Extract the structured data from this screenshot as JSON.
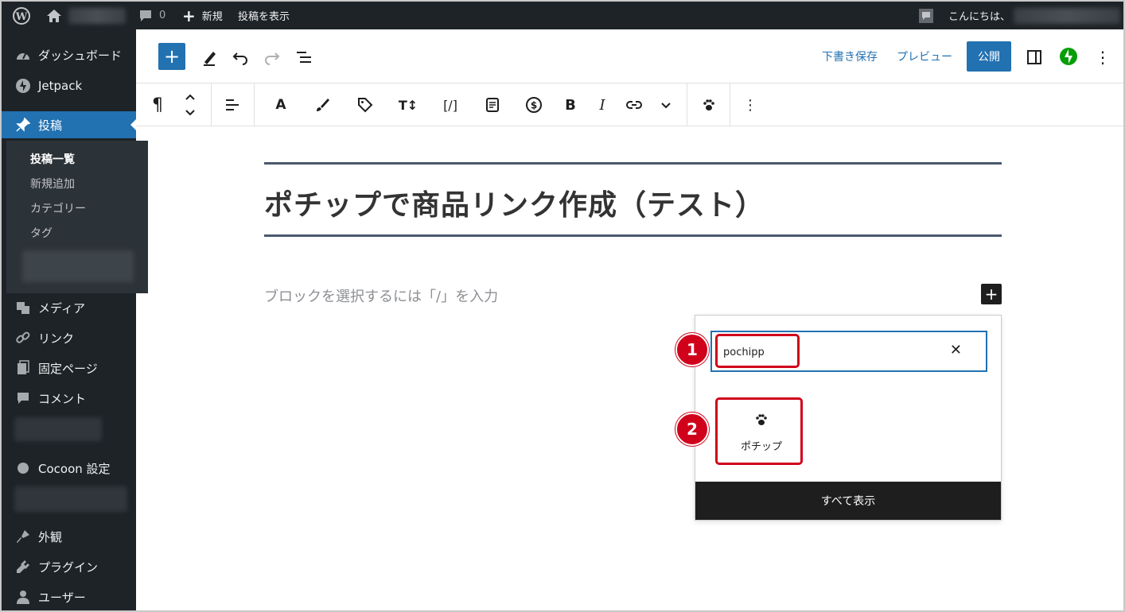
{
  "adminbar": {
    "comments_count": "0",
    "new_label": "新規",
    "view_post_label": "投稿を表示",
    "greeting": "こんにちは、"
  },
  "sidebar": {
    "items": [
      {
        "label": "ダッシュボード",
        "icon": "dashboard-icon"
      },
      {
        "label": "Jetpack",
        "icon": "jetpack-icon"
      },
      {
        "label": "投稿",
        "icon": "pin-icon"
      },
      {
        "label": "メディア",
        "icon": "media-icon"
      },
      {
        "label": "リンク",
        "icon": "link-icon"
      },
      {
        "label": "固定ページ",
        "icon": "page-icon"
      },
      {
        "label": "コメント",
        "icon": "comment-icon"
      },
      {
        "label": "Cocoon 設定",
        "icon": "cocoon-icon"
      },
      {
        "label": "外観",
        "icon": "appearance-icon"
      },
      {
        "label": "プラグイン",
        "icon": "plugin-icon"
      },
      {
        "label": "ユーザー",
        "icon": "user-icon"
      }
    ],
    "submenu": [
      "投稿一覧",
      "新規追加",
      "カテゴリー",
      "タグ"
    ]
  },
  "toolbar": {
    "save_draft": "下書き保存",
    "preview": "プレビュー",
    "publish": "公開"
  },
  "blocktoolbar": {
    "bold": "B",
    "italic": "I",
    "font_a": "A",
    "shortcode": "[/]",
    "typography": "T↕"
  },
  "content": {
    "title": "ポチップで商品リンク作成（テスト）",
    "placeholder": "ブロックを選択するには「/」を入力"
  },
  "inserter": {
    "search_value": "pochipp",
    "result_label": "ポチップ",
    "show_all": "すべて表示"
  },
  "annotations": {
    "step1": "1",
    "step2": "2"
  },
  "colors": {
    "wp_blue": "#2271b1",
    "admin_dark": "#1d2327",
    "annotation_red": "#d0021b",
    "jetpack_green": "#069e08"
  }
}
